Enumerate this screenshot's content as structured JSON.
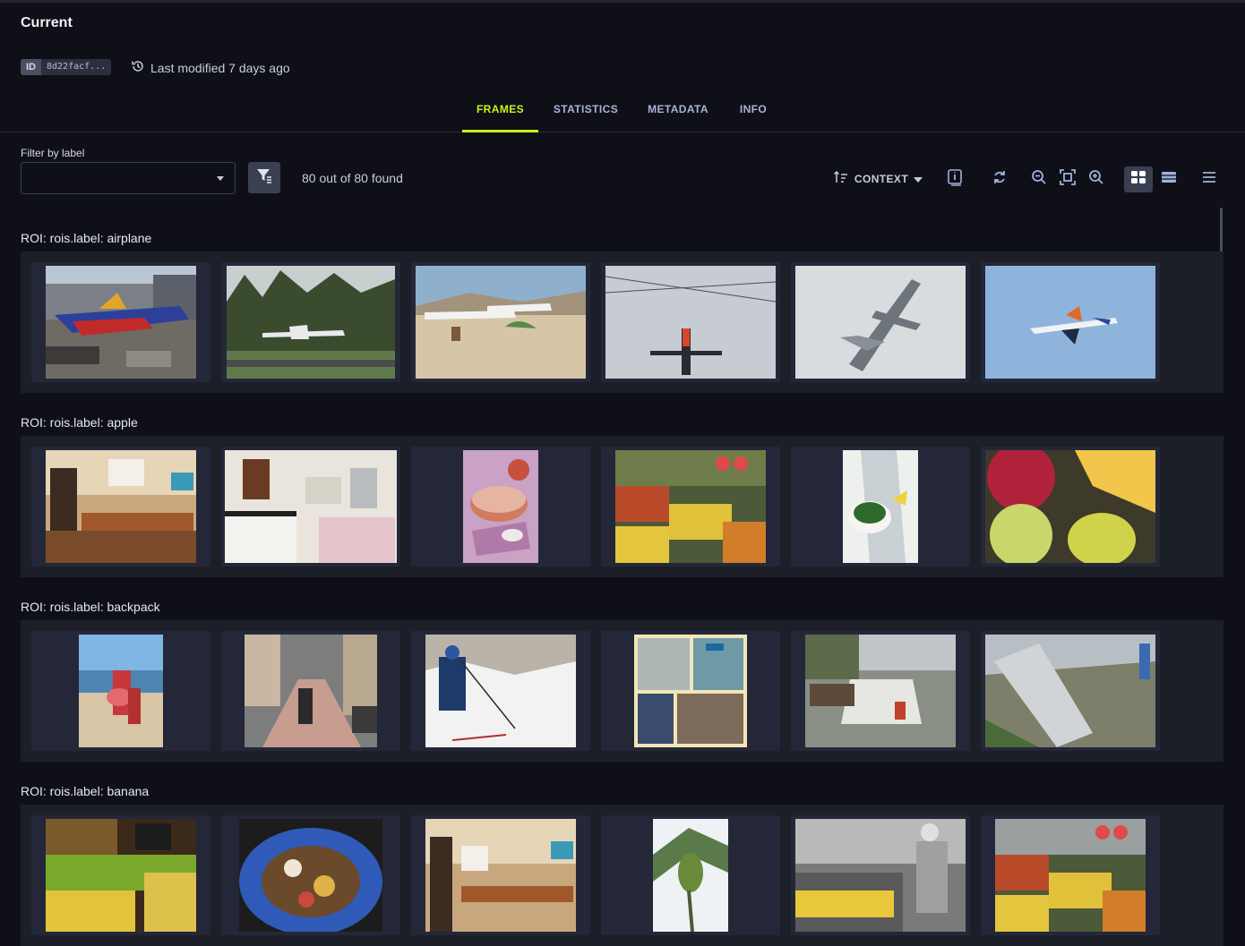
{
  "header": {
    "title": "Current",
    "id_key": "ID",
    "id_value": "8d22facf...",
    "last_modified": "Last modified 7 days ago"
  },
  "tabs": [
    {
      "label": "FRAMES",
      "active": true
    },
    {
      "label": "STATISTICS",
      "active": false
    },
    {
      "label": "METADATA",
      "active": false
    },
    {
      "label": "INFO",
      "active": false
    }
  ],
  "filter": {
    "label": "Filter by label",
    "value": "",
    "found_text": "80 out of 80 found"
  },
  "toolbar": {
    "sort_label": "CONTEXT",
    "icons": [
      "sort-icon",
      "info-icon",
      "refresh-icon",
      "zoom-out-icon",
      "fit-screen-icon",
      "zoom-in-icon",
      "grid-view-icon",
      "list-view-icon",
      "menu-icon"
    ]
  },
  "colors": {
    "accent": "#c8f31d",
    "background": "#0f1017",
    "band": "#1c1e28",
    "card": "#242738"
  },
  "sections": [
    {
      "title": "ROI: rois.label: airplane",
      "thumbs": [
        "airplane-at-gate",
        "plane-over-trees",
        "planes-on-beach",
        "plane-from-below",
        "fighter-jet-fog",
        "jet-in-blue-sky"
      ]
    },
    {
      "title": "ROI: rois.label: apple",
      "thumbs": [
        "kitchen-wood",
        "kitchen-white",
        "apple-crumble",
        "fruit-market",
        "salad-bowl",
        "apple-pear-banana"
      ]
    },
    {
      "title": "ROI: rois.label: backpack",
      "thumbs": [
        "beach-kids",
        "city-street",
        "snow-skier",
        "train-collage",
        "plaza-benches",
        "river-climber"
      ]
    },
    {
      "title": "ROI: rois.label: banana",
      "thumbs": [
        "bananas-market",
        "dessert-bowl",
        "kitchen-wood-2",
        "banana-tree",
        "bw-market",
        "fruit-stand"
      ]
    }
  ]
}
